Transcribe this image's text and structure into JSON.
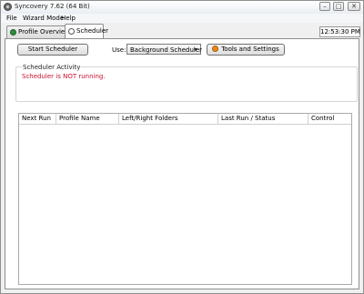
{
  "window": {
    "title": "Syncovery 7.62 (64 Bit)",
    "controls": {
      "minimize": "–",
      "maximize": "□",
      "close": "✕"
    }
  },
  "menu": {
    "items": [
      "File",
      "Wizard Mode",
      "Help"
    ]
  },
  "tabs": [
    {
      "label": "Profile Overview",
      "icon": "profile-overview-icon",
      "active": false
    },
    {
      "label": "Scheduler",
      "icon": "clock-icon",
      "active": true
    }
  ],
  "clock": "12:53:30 PM",
  "toolbar": {
    "start_label": "Start Scheduler",
    "use_label": "Use:",
    "use_value": "Background Scheduler",
    "tools_label": "Tools and Settings"
  },
  "activity": {
    "title": "Scheduler Activity",
    "status": "Scheduler is NOT running."
  },
  "table": {
    "columns": [
      "Next Run",
      "Profile Name",
      "Left/Right Folders",
      "Last Run / Status",
      "Control"
    ],
    "rows": []
  },
  "colors": {
    "status_error": "#c8102e",
    "tools_icon": "#e98a1c"
  }
}
